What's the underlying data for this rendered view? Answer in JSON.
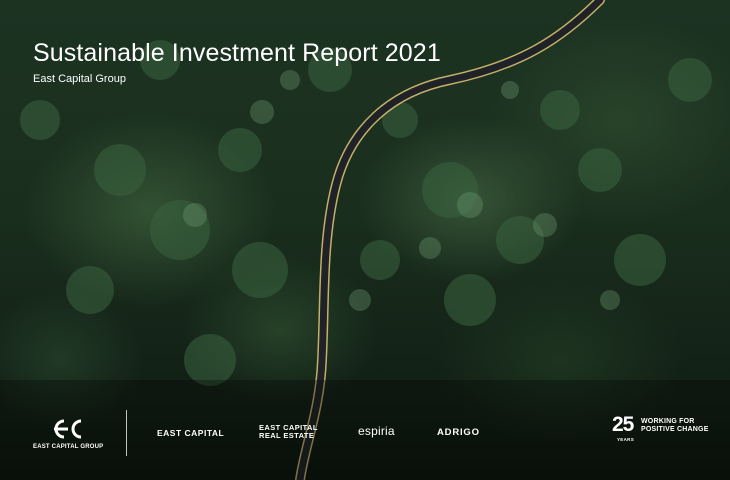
{
  "report": {
    "title": "Sustainable Investment Report 2021",
    "subtitle": "East Capital Group"
  },
  "background": {
    "description_icon": "aerial-forest-road-photo",
    "colors": {
      "forest_dark": "#0c160e",
      "forest_mid": "#1d3322",
      "road": "#1f2226",
      "road_line": "#e2c777"
    }
  },
  "footer": {
    "group_logo_name": "EAST CAPITAL GROUP",
    "brands": {
      "east_capital": "EAST CAPITAL",
      "real_estate_line1": "EAST CAPITAL",
      "real_estate_line2": "REAL ESTATE",
      "espiria": "espiria",
      "adrigo": "ADRIGO"
    },
    "anniversary": {
      "number": "25",
      "years": "YEARS",
      "tagline_line1": "WORKING FOR",
      "tagline_line2": "POSITIVE CHANGE"
    }
  }
}
